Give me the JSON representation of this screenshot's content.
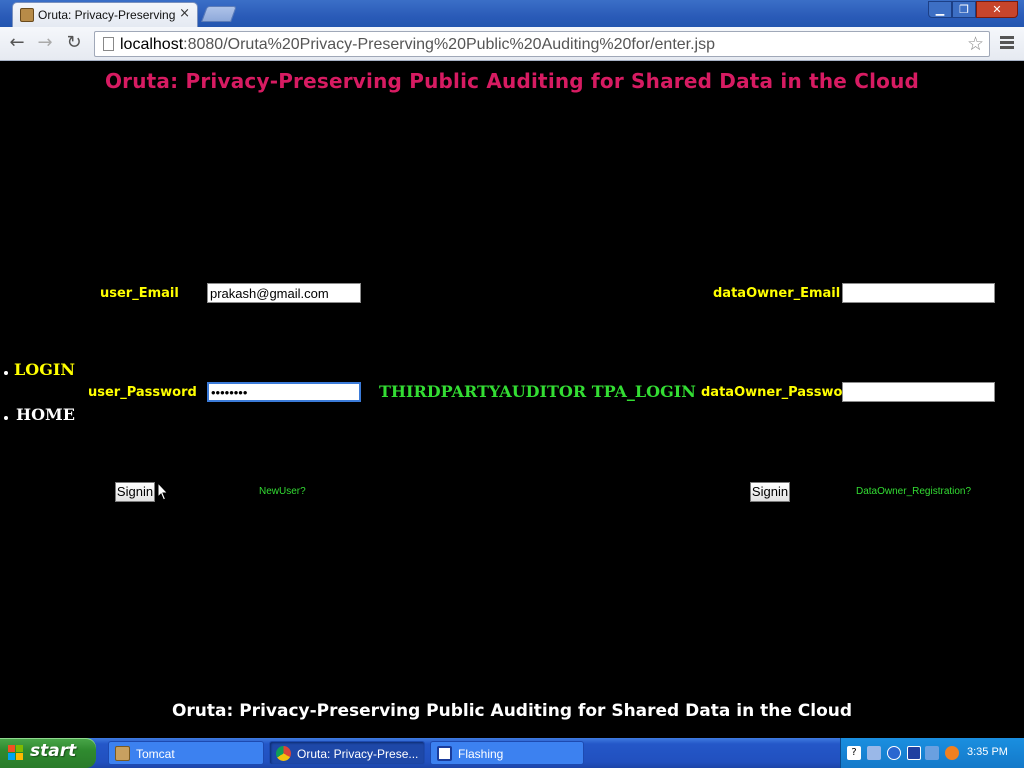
{
  "browser": {
    "tab_title": "Oruta: Privacy-Preserving Pu",
    "tab_close": "×",
    "url_host": "localhost",
    "url_rest": ":8080/Oruta%20Privacy-Preserving%20Public%20Auditing%20for/enter.jsp",
    "window_controls": {
      "minimize": "▁",
      "maximize": "❐",
      "close": "✕"
    },
    "nav": {
      "back": "←",
      "forward": "→",
      "reload": "↻",
      "star": "☆"
    }
  },
  "page": {
    "heading": "Oruta: Privacy-Preserving Public Auditing for Shared Data in the Cloud",
    "footer": "Oruta: Privacy-Preserving Public Auditing for Shared Data in the Cloud",
    "nav": {
      "login": "LOGIN",
      "home": "HOME"
    },
    "user_form": {
      "email_label": "user_Email",
      "email_value": "prakash@gmail.com",
      "password_label": "user_Password",
      "password_value": "prakash1",
      "signin_label": "Signin",
      "newuser_link": "NewUser?"
    },
    "tpa_link": "THIRDPARTYAUDITOR TPA_LOGIN",
    "owner_form": {
      "email_label": "dataOwner_Email",
      "email_value": "",
      "password_label": "dataOwner_Password",
      "password_value": "",
      "signin_label": "Signin",
      "registration_link": "DataOwner_Registration?"
    },
    "colors": {
      "heading": "#d71b62",
      "label": "#ffff00",
      "link_green": "#33dd33",
      "background": "#000000"
    }
  },
  "taskbar": {
    "start_label": "start",
    "tasks": [
      {
        "label": "Tomcat",
        "icon": "tomcat-icon"
      },
      {
        "label": "Oruta: Privacy-Prese...",
        "icon": "chrome-icon"
      },
      {
        "label": "Flashing",
        "icon": "flashing-icon"
      }
    ],
    "clock": "3:35 PM"
  }
}
